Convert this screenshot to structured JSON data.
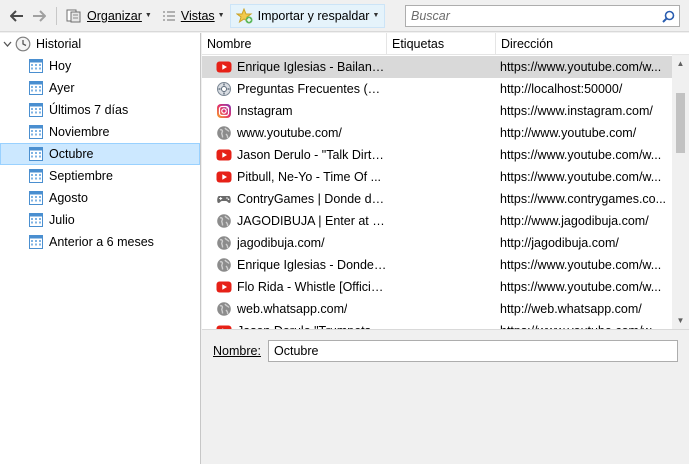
{
  "toolbar": {
    "organize_label": "Organizar",
    "views_label": "Vistas",
    "import_label": "Importar y respaldar",
    "search_placeholder": "Buscar"
  },
  "sidebar": {
    "root_label": "Historial",
    "items": [
      {
        "label": "Hoy"
      },
      {
        "label": "Ayer"
      },
      {
        "label": "Últimos 7 días"
      },
      {
        "label": "Noviembre"
      },
      {
        "label": "Octubre",
        "selected": true
      },
      {
        "label": "Septiembre"
      },
      {
        "label": "Agosto"
      },
      {
        "label": "Julio"
      },
      {
        "label": "Anterior a 6 meses"
      }
    ]
  },
  "table": {
    "columns": [
      "Nombre",
      "Etiquetas",
      "Dirección"
    ],
    "rows": [
      {
        "icon": "youtube-icon",
        "name": "Enrique Iglesias - Bailando...",
        "tags": "",
        "url": "https://www.youtube.com/w...",
        "selected": true
      },
      {
        "icon": "page-gear-icon",
        "name": "Preguntas Frecuentes (Co...",
        "tags": "",
        "url": "http://localhost:50000/"
      },
      {
        "icon": "instagram-icon",
        "name": "Instagram",
        "tags": "",
        "url": "https://www.instagram.com/"
      },
      {
        "icon": "globe-icon",
        "name": "www.youtube.com/",
        "tags": "",
        "url": "http://www.youtube.com/"
      },
      {
        "icon": "youtube-icon",
        "name": "Jason Derulo - \"Talk Dirty\"...",
        "tags": "",
        "url": "https://www.youtube.com/w..."
      },
      {
        "icon": "youtube-icon",
        "name": "Pitbull, Ne-Yo - Time Of ...",
        "tags": "",
        "url": "https://www.youtube.com/w..."
      },
      {
        "icon": "controller-icon",
        "name": "ContryGames | Donde des...",
        "tags": "",
        "url": "https://www.contrygames.co..."
      },
      {
        "icon": "globe-icon",
        "name": "JAGODIBUJA | Enter at you...",
        "tags": "",
        "url": "http://www.jagodibuja.com/"
      },
      {
        "icon": "globe-icon",
        "name": "jagodibuja.com/",
        "tags": "",
        "url": "http://jagodibuja.com/"
      },
      {
        "icon": "globe-icon",
        "name": "Enrique Iglesias - Donde E...",
        "tags": "",
        "url": "https://www.youtube.com/w..."
      },
      {
        "icon": "youtube-icon",
        "name": "Flo Rida - Whistle [Official...",
        "tags": "",
        "url": "https://www.youtube.com/w..."
      },
      {
        "icon": "globe-icon",
        "name": "web.whatsapp.com/",
        "tags": "",
        "url": "http://web.whatsapp.com/"
      },
      {
        "icon": "youtube-icon",
        "name": "Jason Derulo \"Trumpets\" (...",
        "tags": "",
        "url": "https://www.youtube.com/w..."
      }
    ]
  },
  "details": {
    "name_label": "Nombre:",
    "name_value": "Octubre"
  },
  "colors": {
    "selected_sidebar": "#cce8ff",
    "selected_row": "#d9d9d9",
    "youtube_red": "#e62117",
    "instagram": "#c13584"
  }
}
